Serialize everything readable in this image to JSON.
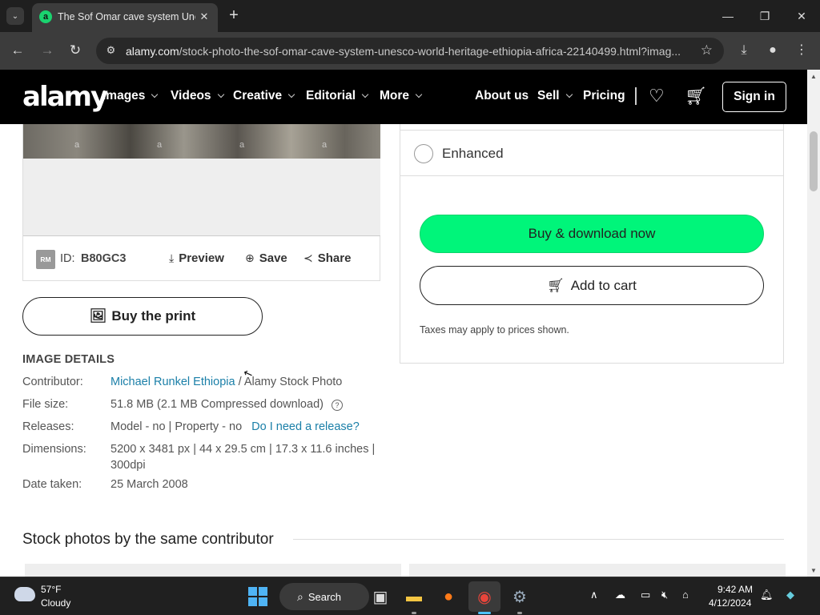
{
  "browser": {
    "tab_title": "The Sof Omar cave system Une",
    "tab_favicon": "a",
    "url_domain": "alamy.com",
    "url_path": "/stock-photo-the-sof-omar-cave-system-unesco-world-heritage-ethiopia-africa-22140499.html?imag..."
  },
  "header": {
    "logo": "alamy",
    "nav": [
      {
        "label": "Images"
      },
      {
        "label": "Videos"
      },
      {
        "label": "Creative"
      },
      {
        "label": "Editorial"
      },
      {
        "label": "More"
      }
    ],
    "about": "About us",
    "sell": "Sell",
    "pricing": "Pricing",
    "sign_in": "Sign in"
  },
  "photo_card": {
    "watermark": "a",
    "badge": "RM",
    "id_label": "ID:",
    "id_value": "B80GC3",
    "preview": "Preview",
    "save": "Save",
    "share": "Share"
  },
  "print_button": "Buy the print",
  "details": {
    "heading": "IMAGE DETAILS",
    "contributor_label": "Contributor:",
    "contributor_name": "Michael Runkel Ethiopia",
    "contributor_agency": " / Alamy Stock Photo",
    "filesize_label": "File size:",
    "filesize_value": "51.8 MB (2.1 MB Compressed download)",
    "releases_label": "Releases:",
    "releases_value": "Model - no | Property - no",
    "releases_link": "Do I need a release?",
    "dimensions_label": "Dimensions:",
    "dimensions_value": "5200 x 3481 px | 44 x 29.5 cm | 17.3 x 11.6 inches | 300dpi",
    "date_label": "Date taken:",
    "date_value": "25 March 2008"
  },
  "purchase": {
    "option_label": "Enhanced",
    "buy_now": "Buy & download now",
    "add_to_cart": "Add to cart",
    "taxes_note": "Taxes may apply to prices shown."
  },
  "section_title": "Stock photos by the same contributor",
  "taskbar": {
    "temperature": "57°F",
    "condition": "Cloudy",
    "search": "Search",
    "time": "9:42 AM",
    "date": "4/12/2024"
  }
}
